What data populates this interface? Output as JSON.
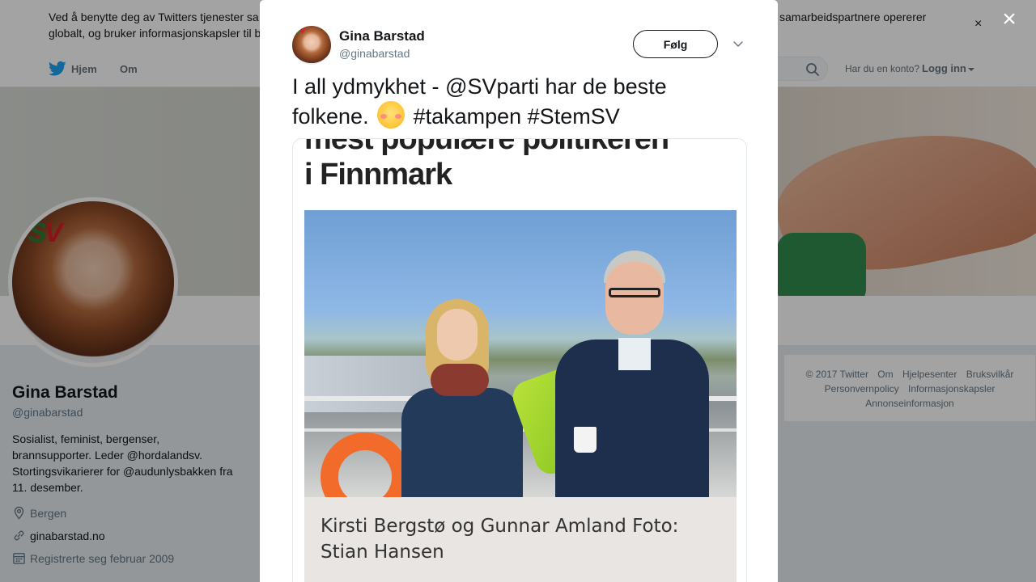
{
  "cookie_bar": {
    "text_left": "Ved å benytte deg av Twitters tjenester sa",
    "text_left_line2": "globalt, og bruker informasjonskapsler til b",
    "text_right": "samarbeidspartnere opererer",
    "close_label": "×"
  },
  "topnav": {
    "home_label": "Hjem",
    "about_label": "Om",
    "account_question": "Har du en konto?",
    "login_label": "Logg inn"
  },
  "profile": {
    "name": "Gina Barstad",
    "handle": "@ginabarstad",
    "bio_line1": "Sosialist, feminist, bergenser,",
    "bio_line2": "brannsupporter. Leder ",
    "bio_mention1": "@hordalandsv",
    "bio_line2_end": ".",
    "bio_line3": "Stortingsvikarierer for ",
    "bio_mention2": "@audunlysbakken",
    "bio_line3_end": " fra",
    "bio_line4": "11. desember.",
    "location": "Bergen",
    "website": "ginabarstad.no",
    "joined": "Registrerte seg februar 2009"
  },
  "footer": {
    "copyright": "© 2017 Twitter",
    "about": "Om",
    "help": "Hjelpesenter",
    "terms": "Bruksvilkår",
    "privacy": "Personvernpolicy",
    "cookies": "Informasjonskapsler",
    "ads": "Annonseinformasjon"
  },
  "modal": {
    "close_label": "×",
    "author_name": "Gina Barstad",
    "author_handle": "@ginabarstad",
    "follow_label": "Følg",
    "tweet_part1": "I all ydmykhet - ",
    "tweet_mention": "@SVparti",
    "tweet_part2": " har de beste folkene. ",
    "tweet_hashtags": " #takampen #StemSV",
    "media_headline_line1": "mest populære politikeren",
    "media_headline_line2": "i Finnmark",
    "media_caption": "Kirsti Bergstø og Gunnar Amland Foto: Stian Hansen"
  },
  "colors": {
    "twitter_blue": "#1da1f2",
    "link_blue": "#1b95e0",
    "text_dark": "#14171a",
    "text_muted": "#657786",
    "overlay": "rgba(0,0,0,0.36)"
  },
  "icons": {
    "home": "twitter-bird-icon",
    "search": "search-icon",
    "location": "location-pin-icon",
    "link": "link-icon",
    "calendar": "calendar-icon",
    "more": "chevron-down-icon",
    "close": "close-icon"
  }
}
